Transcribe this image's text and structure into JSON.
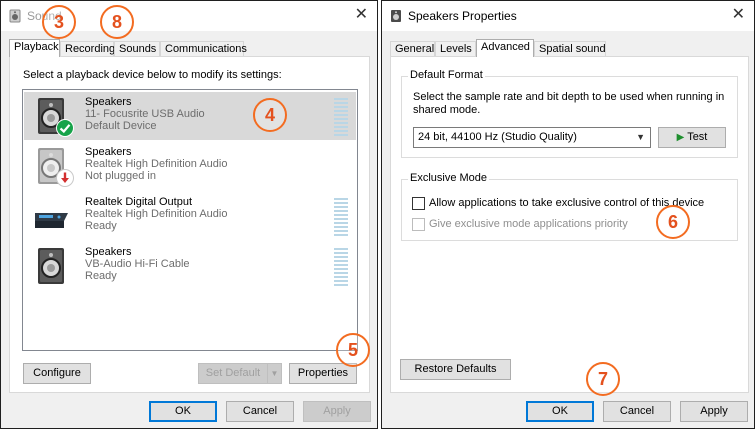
{
  "sound_window": {
    "title": "Sound",
    "tabs": [
      "Playback",
      "Recording",
      "Sounds",
      "Communications"
    ],
    "instruction": "Select a playback device below to modify its settings:",
    "devices": [
      {
        "name": "Speakers",
        "line2": "11- Focusrite USB Audio",
        "line3": "Default Device",
        "status": "default"
      },
      {
        "name": "Speakers",
        "line2": "Realtek High Definition Audio",
        "line3": "Not plugged in",
        "status": "unplugged"
      },
      {
        "name": "Realtek Digital Output",
        "line2": "Realtek High Definition Audio",
        "line3": "Ready",
        "status": "ready"
      },
      {
        "name": "Speakers",
        "line2": "VB-Audio Hi-Fi Cable",
        "line3": "Ready",
        "status": "ready"
      }
    ],
    "buttons": {
      "configure": "Configure",
      "set_default": "Set Default",
      "properties": "Properties",
      "ok": "OK",
      "cancel": "Cancel",
      "apply": "Apply"
    }
  },
  "speakers_window": {
    "title": "Speakers Properties",
    "tabs": [
      "General",
      "Levels",
      "Advanced",
      "Spatial sound"
    ],
    "default_format": {
      "group_label": "Default Format",
      "description": "Select the sample rate and bit depth to be used when running in shared mode.",
      "selected": "24 bit, 44100 Hz (Studio Quality)",
      "test_label": "Test"
    },
    "exclusive_mode": {
      "group_label": "Exclusive Mode",
      "allow_label": "Allow applications to take exclusive control of this device",
      "priority_label": "Give exclusive mode applications priority"
    },
    "buttons": {
      "restore_defaults": "Restore Defaults",
      "ok": "OK",
      "cancel": "Cancel",
      "apply": "Apply"
    }
  },
  "annotations": [
    "3",
    "8",
    "4",
    "5",
    "6",
    "7"
  ],
  "colors": {
    "annotation": "#f36c21",
    "selected_row": "#d9d9d9",
    "default_check": "#17a34a",
    "unplugged": "#d32f2f",
    "play_icon": "#1e8f2e"
  }
}
